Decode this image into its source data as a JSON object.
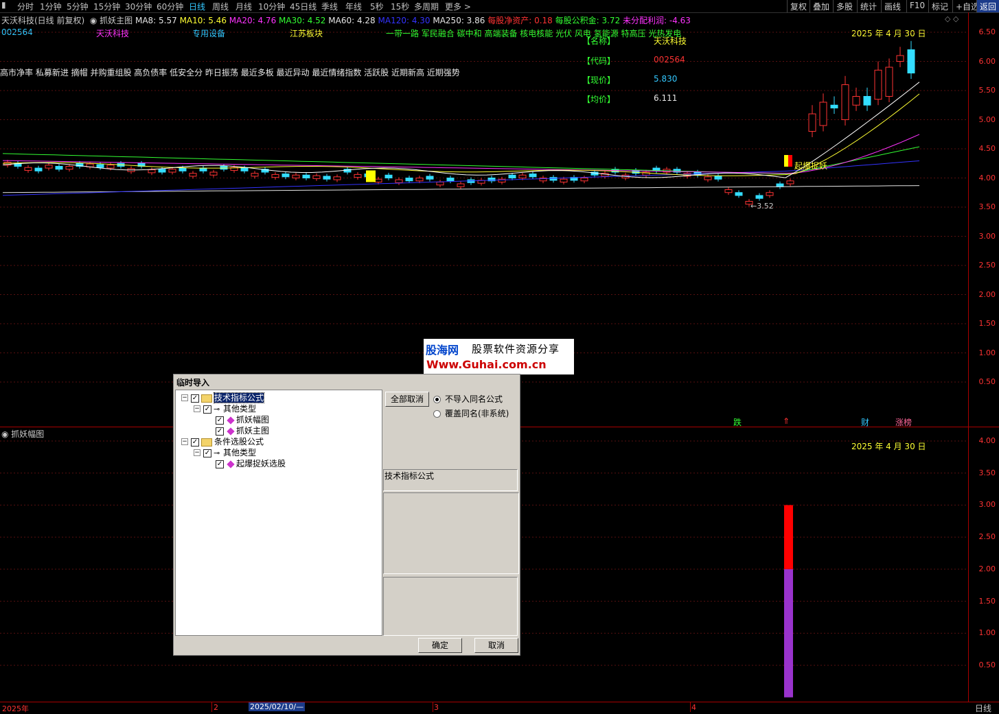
{
  "toolbar": {
    "periods": [
      "分时",
      "1分钟",
      "5分钟",
      "15分钟",
      "30分钟",
      "60分钟",
      "日线",
      "周线",
      "月线",
      "10分钟",
      "45日线",
      "季线",
      "年线",
      "5秒",
      "15秒",
      "多周期",
      "更多 >"
    ],
    "right_buttons": [
      "复权",
      "叠加",
      "多股",
      "统计",
      "画线",
      "F10",
      "标记",
      "+自选",
      "返回"
    ]
  },
  "header": {
    "stock_title": "天沃科技(日线 前复权)",
    "indicator_name": "抓妖主图",
    "ma": [
      {
        "label": "MA8: 5.57",
        "color": "#e6e6e6"
      },
      {
        "label": "MA10: 5.46",
        "color": "#ffff33"
      },
      {
        "label": "MA20: 4.76",
        "color": "#ff33ff"
      },
      {
        "label": "MA30: 4.52",
        "color": "#33ff33"
      },
      {
        "label": "MA60: 4.28",
        "color": "#e6e6e6"
      },
      {
        "label": "MA120: 4.30",
        "color": "#3333ff"
      },
      {
        "label": "MA250: 3.86",
        "color": "#e6e6e6"
      }
    ],
    "finance": [
      {
        "label": "每股净资产: 0.18",
        "color": "#ff3333"
      },
      {
        "label": "每股公积金: 3.72",
        "color": "#33ff33"
      },
      {
        "label": "未分配利润: -4.63",
        "color": "#ff33ff"
      }
    ]
  },
  "info_row": {
    "code": "002564",
    "name": "天沃科技",
    "industry": "专用设备",
    "region": "江苏板块",
    "concepts": "一带一路 军民融合 碳中和 高端装备 核电核能 光伏 风电 氢能源 特高压 光热发电",
    "date": "2025 年 4 月 30 日"
  },
  "tags_line": "高市净率 私募新进 摘帽 并购重组股 高负债率 低安全分 昨日振荡 最近多板 最近异动 最近情绪指数 活跃股 近期新高 近期强势",
  "quote_box": {
    "name_label": "【名称】",
    "name_value": "天沃科技",
    "code_label": "【代码】",
    "code_value": "002564",
    "price_label": "【现价】",
    "price_value": "5.830",
    "avg_label": "【均价】",
    "avg_value": "6.111"
  },
  "main_chart": {
    "signal_label": "起爆捉妖",
    "low_label": "3.52",
    "y_ticks": [
      "6.50",
      "6.00",
      "5.50",
      "5.00",
      "4.50",
      "4.00",
      "3.50",
      "3.00",
      "2.50",
      "2.00",
      "1.50",
      "1.00",
      "0.50"
    ],
    "markers": [
      {
        "text": "跌",
        "color": "#33ff33"
      },
      {
        "text": "⇑",
        "color": "#ff3333"
      },
      {
        "text": "财",
        "color": "#33c8ff"
      },
      {
        "text": "涨榜",
        "color": "#ff6699"
      }
    ]
  },
  "sub_chart": {
    "title": "抓妖幅图",
    "date": "2025 年 4 月 30 日",
    "y_ticks": [
      "4.00",
      "3.50",
      "3.00",
      "2.50",
      "2.00",
      "1.50",
      "1.00",
      "0.50"
    ],
    "bar": {
      "red_top": 3.0,
      "purple_top": 2.0,
      "bottom": 0.0
    },
    "colors": {
      "red": "#ff0000",
      "purple": "#9933cc"
    }
  },
  "bottom_axis": {
    "year": "2025年",
    "m2": "2",
    "cursor_date": "2025/02/10/—",
    "m3": "3",
    "m4": "4",
    "period": "日线"
  },
  "dialog": {
    "title": "临时导入",
    "tree": [
      {
        "label": "技术指标公式",
        "level": 0,
        "type": "folder",
        "selected": true
      },
      {
        "label": "其他类型",
        "level": 1,
        "type": "key"
      },
      {
        "label": "抓妖幅图",
        "level": 2,
        "type": "gem"
      },
      {
        "label": "抓妖主图",
        "level": 2,
        "type": "gem"
      },
      {
        "label": "条件选股公式",
        "level": 0,
        "type": "folder"
      },
      {
        "label": "其他类型",
        "level": 1,
        "type": "key"
      },
      {
        "label": "起爆捉妖选股",
        "level": 2,
        "type": "gem"
      }
    ],
    "deselect_all": "全部取消",
    "radio_skip": "不导入同名公式",
    "radio_overwrite": "覆盖同名(非系统)",
    "section_label": "技术指标公式",
    "ok": "确定",
    "cancel": "取消"
  },
  "watermark": {
    "line1a": "股海网",
    "line1b": "股票软件资源分享",
    "line2": "Www.Guhai.com.cn"
  }
}
